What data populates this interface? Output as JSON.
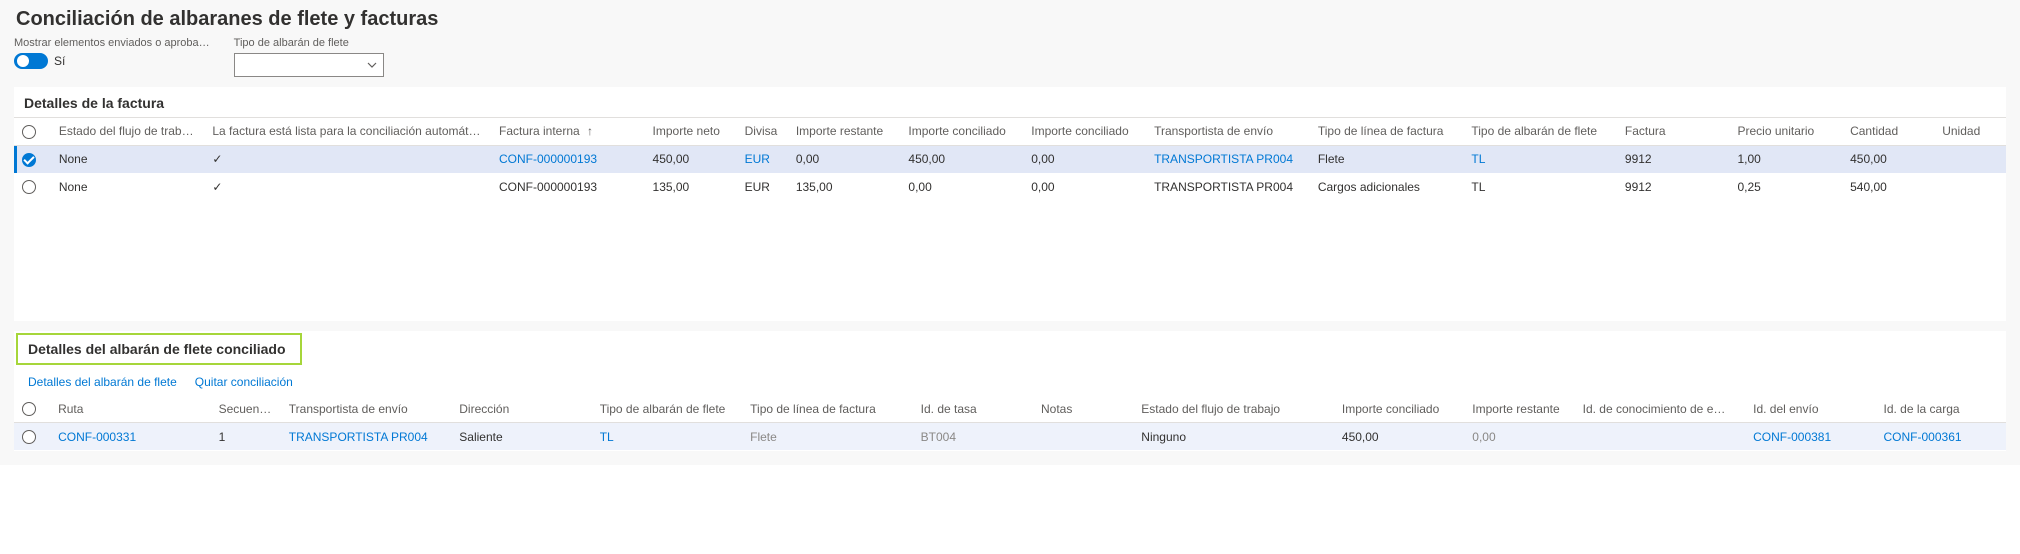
{
  "page": {
    "title": "Conciliación de albaranes de flete y facturas"
  },
  "filters": {
    "show_sent_label": "Mostrar elementos enviados o aproba…",
    "show_sent_value": "Sí",
    "type_label": "Tipo de albarán de flete",
    "type_value": ""
  },
  "invoice_details": {
    "title": "Detalles de la factura",
    "columns": {
      "workflow_state": "Estado del flujo de trabajo",
      "ready_auto": "La factura está lista para la conciliación automáti…",
      "internal_invoice": "Factura interna",
      "net_amount": "Importe neto",
      "currency": "Divisa",
      "remaining": "Importe restante",
      "reconciled": "Importe conciliado",
      "reconciled2": "Importe conciliado",
      "carrier": "Transportista de envío",
      "line_type": "Tipo de línea de factura",
      "fb_type": "Tipo de albarán de flete",
      "invoice": "Factura",
      "unit_price": "Precio unitario",
      "quantity": "Cantidad",
      "unit": "Unidad"
    },
    "rows": [
      {
        "selected": true,
        "workflow_state": "None",
        "ready_auto": true,
        "internal_invoice": "CONF-000000193",
        "internal_invoice_link": true,
        "net_amount": "450,00",
        "currency": "EUR",
        "currency_link": true,
        "remaining": "0,00",
        "reconciled": "450,00",
        "reconciled2": "0,00",
        "carrier": "TRANSPORTISTA PR004",
        "carrier_link": true,
        "line_type": "Flete",
        "fb_type": "TL",
        "fb_type_link": true,
        "invoice": "9912",
        "unit_price": "1,00",
        "quantity": "450,00",
        "unit": ""
      },
      {
        "selected": false,
        "workflow_state": "None",
        "ready_auto": true,
        "internal_invoice": "CONF-000000193",
        "internal_invoice_link": false,
        "net_amount": "135,00",
        "currency": "EUR",
        "currency_link": false,
        "remaining": "135,00",
        "reconciled": "0,00",
        "reconciled2": "0,00",
        "carrier": "TRANSPORTISTA PR004",
        "carrier_link": false,
        "line_type": "Cargos adicionales",
        "fb_type": "TL",
        "fb_type_link": false,
        "invoice": "9912",
        "unit_price": "0,25",
        "quantity": "540,00",
        "unit": ""
      }
    ]
  },
  "matched_details": {
    "title": "Detalles del albarán de flete conciliado",
    "actions": {
      "details": "Detalles del albarán de flete",
      "remove": "Quitar conciliación"
    },
    "columns": {
      "route": "Ruta",
      "sequence": "Secuencia",
      "carrier": "Transportista de envío",
      "direction": "Dirección",
      "fb_type": "Tipo de albarán de flete",
      "line_type": "Tipo de línea de factura",
      "rate_id": "Id. de tasa",
      "notes": "Notas",
      "workflow_state": "Estado del flujo de trabajo",
      "reconciled": "Importe conciliado",
      "remaining": "Importe restante",
      "bol_id": "Id. de conocimiento de e…",
      "shipment_id": "Id. del envío",
      "load_id": "Id. de la carga"
    },
    "rows": [
      {
        "selected": false,
        "route": "CONF-000331",
        "route_link": true,
        "sequence": "1",
        "carrier": "TRANSPORTISTA PR004",
        "carrier_link": true,
        "direction": "Saliente",
        "fb_type": "TL",
        "fb_type_link": true,
        "line_type": "Flete",
        "line_type_muted": true,
        "rate_id": "BT004",
        "rate_id_muted": true,
        "notes": "",
        "workflow_state": "Ninguno",
        "reconciled": "450,00",
        "remaining": "0,00",
        "remaining_muted": true,
        "bol_id": "",
        "shipment_id": "CONF-000381",
        "shipment_id_link": true,
        "load_id": "CONF-000361",
        "load_id_link": true
      }
    ]
  }
}
